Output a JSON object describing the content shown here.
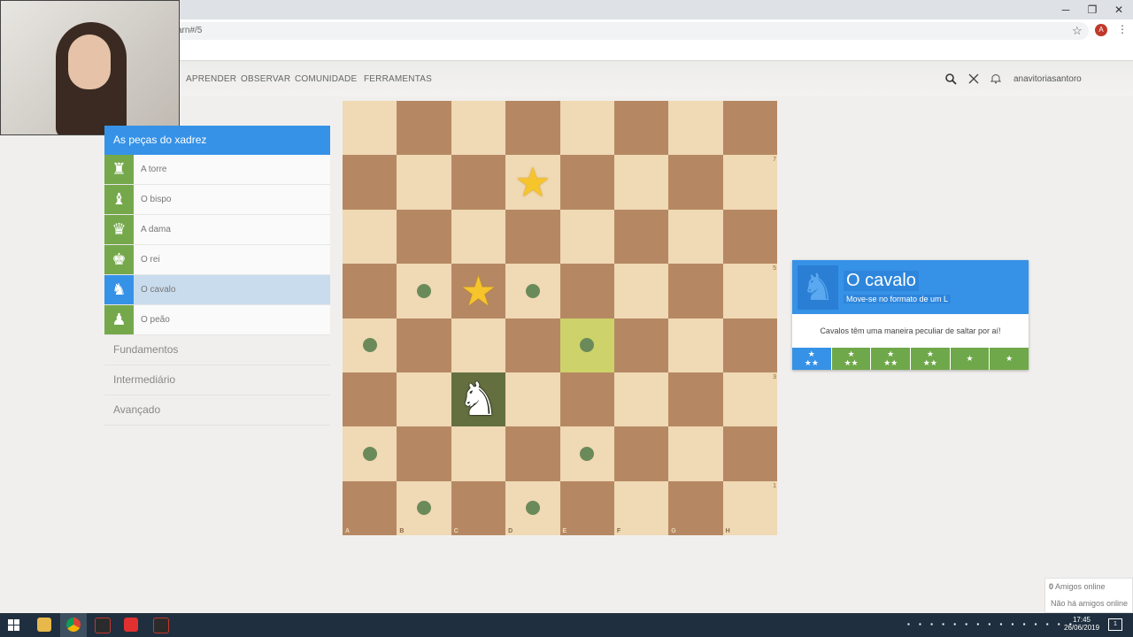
{
  "browser": {
    "address": "arn#/5",
    "profile_initial": "A",
    "minimize_glyph": "─",
    "maximize_glyph": "❐",
    "close_glyph": "✕"
  },
  "nav": {
    "items": [
      "APRENDER",
      "OBSERVAR",
      "COMUNIDADE",
      "FERRAMENTAS"
    ],
    "username": "anavitoriasantoro"
  },
  "sidebar": {
    "header": "As peças do xadrez",
    "pieces": [
      {
        "label": "A torre",
        "icon": "♜"
      },
      {
        "label": "O bispo",
        "icon": "♝"
      },
      {
        "label": "A dama",
        "icon": "♛"
      },
      {
        "label": "O rei",
        "icon": "♚"
      },
      {
        "label": "O cavalo",
        "icon": "♞"
      },
      {
        "label": "O peão",
        "icon": "♟"
      }
    ],
    "groups": [
      "Fundamentos",
      "Intermediário",
      "Avançado"
    ]
  },
  "board": {
    "files": [
      "A",
      "B",
      "C",
      "D",
      "E",
      "F",
      "G",
      "H"
    ],
    "rank_labels": [
      "",
      "7",
      "",
      "5",
      "",
      "3",
      "",
      "1"
    ],
    "knight": "♞",
    "star": "★"
  },
  "lesson": {
    "icon": "♞",
    "title": "O cavalo",
    "subtitle": "Move-se no formato de um L",
    "description": "Cavalos têm uma maneira peculiar de saltar por aí!",
    "stages": [
      {
        "top": "★",
        "bottom": "★★"
      },
      {
        "top": "★",
        "bottom": "★★"
      },
      {
        "top": "★",
        "bottom": "★★"
      },
      {
        "top": "★",
        "bottom": "★★"
      },
      {
        "top": "",
        "bottom": "★"
      },
      {
        "top": "",
        "bottom": "★"
      }
    ]
  },
  "friends": {
    "count": "0",
    "label": "Amigos online",
    "empty": "Não há amigos online"
  },
  "taskbar": {
    "time": "17:45",
    "date": "26/06/2019",
    "notifications": "1"
  }
}
